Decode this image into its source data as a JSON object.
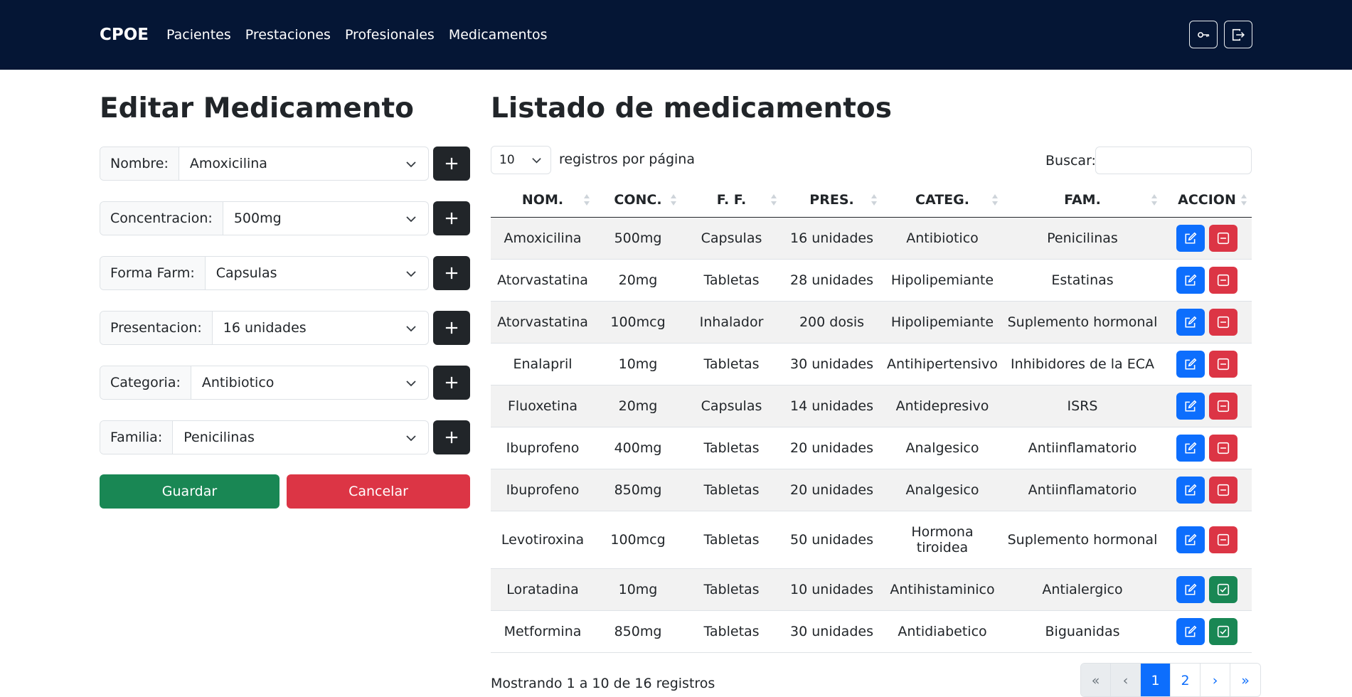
{
  "navbar": {
    "brand": "CPOE",
    "links": [
      "Pacientes",
      "Prestaciones",
      "Profesionales",
      "Medicamentos"
    ],
    "icons": [
      "key-icon",
      "logout-icon"
    ]
  },
  "form": {
    "title": "Editar Medicamento",
    "fields": [
      {
        "label": "Nombre:",
        "value": "Amoxicilina"
      },
      {
        "label": "Concentracion:",
        "value": "500mg"
      },
      {
        "label": "Forma Farm:",
        "value": "Capsulas"
      },
      {
        "label": "Presentacion:",
        "value": "16 unidades"
      },
      {
        "label": "Categoria:",
        "value": "Antibiotico"
      },
      {
        "label": "Familia:",
        "value": "Penicilinas"
      }
    ],
    "save_label": "Guardar",
    "cancel_label": "Cancelar"
  },
  "list": {
    "title": "Listado de medicamentos",
    "page_length": "10",
    "page_length_text": "registros por página",
    "search_label": "Buscar:",
    "search_value": "",
    "columns": [
      "NOM.",
      "CONC.",
      "F. F.",
      "PRES.",
      "CATEG.",
      "FAM.",
      "ACCION"
    ],
    "rows": [
      {
        "nom": "Amoxicilina",
        "conc": "500mg",
        "ff": "Capsulas",
        "pres": "16 unidades",
        "categ": "Antibiotico",
        "fam": "Penicilinas",
        "active": true
      },
      {
        "nom": "Atorvastatina",
        "conc": "20mg",
        "ff": "Tabletas",
        "pres": "28 unidades",
        "categ": "Hipolipemiante",
        "fam": "Estatinas",
        "active": true
      },
      {
        "nom": "Atorvastatina",
        "conc": "100mcg",
        "ff": "Inhalador",
        "pres": "200 dosis",
        "categ": "Hipolipemiante",
        "fam": "Suplemento hormonal",
        "active": true
      },
      {
        "nom": "Enalapril",
        "conc": "10mg",
        "ff": "Tabletas",
        "pres": "30 unidades",
        "categ": "Antihipertensivo",
        "fam": "Inhibidores de la ECA",
        "active": true
      },
      {
        "nom": "Fluoxetina",
        "conc": "20mg",
        "ff": "Capsulas",
        "pres": "14 unidades",
        "categ": "Antidepresivo",
        "fam": "ISRS",
        "active": true
      },
      {
        "nom": "Ibuprofeno",
        "conc": "400mg",
        "ff": "Tabletas",
        "pres": "20 unidades",
        "categ": "Analgesico",
        "fam": "Antiinflamatorio",
        "active": true
      },
      {
        "nom": "Ibuprofeno",
        "conc": "850mg",
        "ff": "Tabletas",
        "pres": "20 unidades",
        "categ": "Analgesico",
        "fam": "Antiinflamatorio",
        "active": true
      },
      {
        "nom": "Levotiroxina",
        "conc": "100mcg",
        "ff": "Tabletas",
        "pres": "50 unidades",
        "categ": "Hormona tiroidea",
        "fam": "Suplemento hormonal",
        "active": true
      },
      {
        "nom": "Loratadina",
        "conc": "10mg",
        "ff": "Tabletas",
        "pres": "10 unidades",
        "categ": "Antihistaminico",
        "fam": "Antialergico",
        "active": false
      },
      {
        "nom": "Metformina",
        "conc": "850mg",
        "ff": "Tabletas",
        "pres": "30 unidades",
        "categ": "Antidiabetico",
        "fam": "Biguanidas",
        "active": false
      }
    ],
    "info": "Mostrando 1 a 10 de 16 registros",
    "pagination": [
      "«",
      "‹",
      "1",
      "2",
      "›",
      "»"
    ]
  },
  "colors": {
    "navbar": "#051635",
    "primary": "#0d6efd",
    "success": "#198754",
    "danger": "#dc3545",
    "dark": "#212529"
  }
}
